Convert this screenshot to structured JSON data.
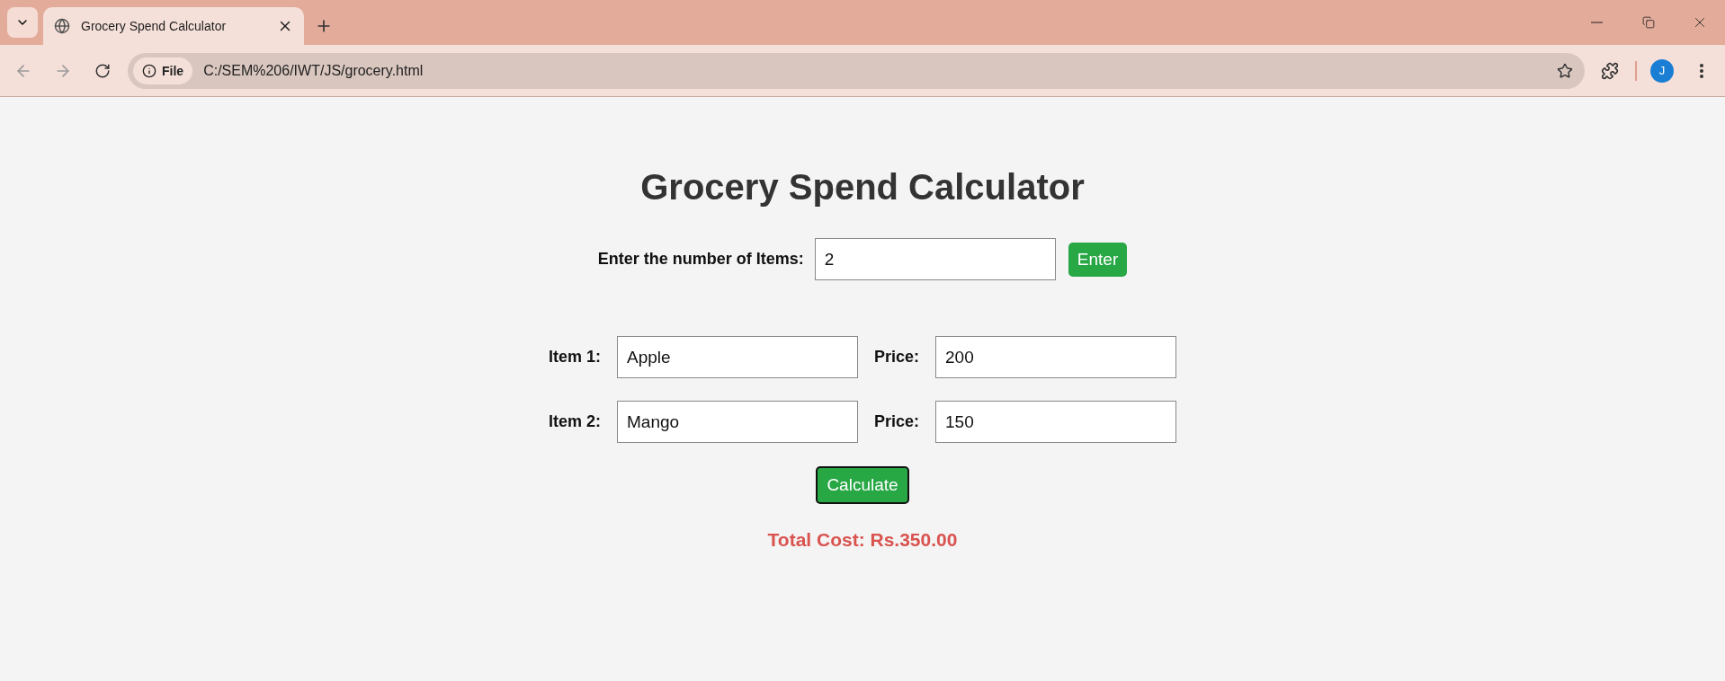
{
  "browser": {
    "tab": {
      "title": "Grocery Spend Calculator",
      "selected": true
    },
    "address": {
      "scheme": "File",
      "url": "C:/SEM%206/IWT/JS/grocery.html"
    },
    "profile": "J"
  },
  "page": {
    "title": "Grocery Spend Calculator",
    "count": {
      "label": "Enter the number of Items:",
      "value": "2",
      "button": "Enter"
    },
    "items": [
      {
        "label": "Item 1:",
        "name": "Apple",
        "price_label": "Price:",
        "price": "200"
      },
      {
        "label": "Item 2:",
        "name": "Mango",
        "price_label": "Price:",
        "price": "150"
      }
    ],
    "calculate": {
      "label": "Calculate",
      "focused": true
    },
    "total": "Total Cost: Rs.350.00"
  }
}
